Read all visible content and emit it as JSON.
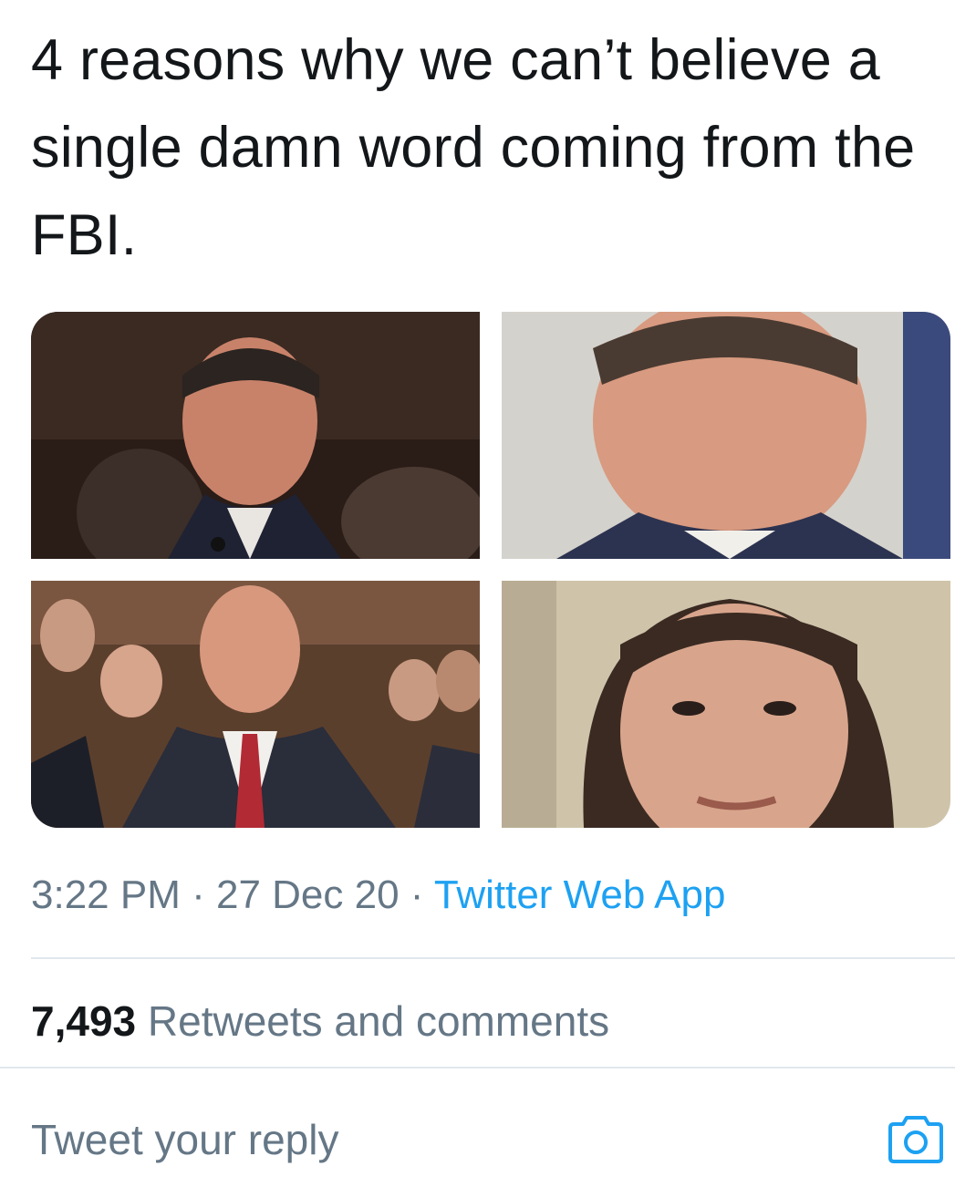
{
  "tweet": {
    "text": "4 reasons why we can’t believe a single damn word coming from the FBI."
  },
  "media": {
    "photos": [
      {
        "id": "photo-1"
      },
      {
        "id": "photo-2"
      },
      {
        "id": "photo-3"
      },
      {
        "id": "photo-4"
      }
    ]
  },
  "meta": {
    "time": "3:22 PM",
    "separator": " · ",
    "date": "27 Dec 20",
    "source": "Twitter Web App"
  },
  "stats": {
    "count": "7,493",
    "label": "Retweets and comments"
  },
  "reply": {
    "placeholder": "Tweet your reply",
    "camera_icon": "camera-icon"
  },
  "colors": {
    "text": "#14171a",
    "secondary": "#657786",
    "accent": "#1da1f2",
    "divider": "#e1e8ed"
  }
}
